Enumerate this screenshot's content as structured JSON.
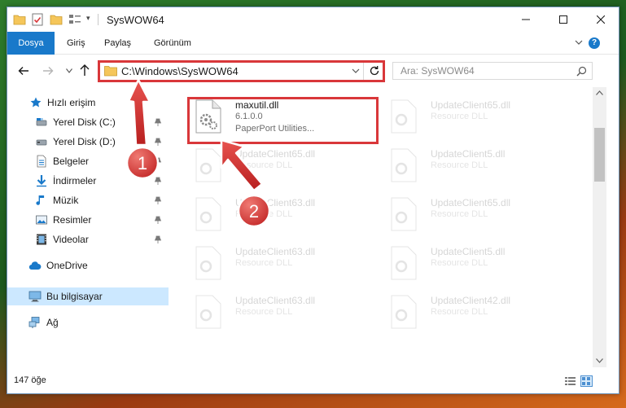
{
  "window": {
    "title": "SysWOW64"
  },
  "ribbon": {
    "tabs": [
      {
        "label": "Dosya"
      },
      {
        "label": "Giriş"
      },
      {
        "label": "Paylaş"
      },
      {
        "label": "Görünüm"
      }
    ],
    "help_label": "?"
  },
  "address": {
    "path": "C:\\Windows\\SysWOW64"
  },
  "search": {
    "placeholder": "Ara: SysWOW64"
  },
  "sidebar": {
    "items": [
      {
        "label": "Hızlı erişim",
        "icon": "star-icon",
        "pinned": false
      },
      {
        "label": "Yerel Disk (C:)",
        "icon": "drive-icon",
        "pinned": true
      },
      {
        "label": "Yerel Disk (D:)",
        "icon": "drive-icon",
        "pinned": true
      },
      {
        "label": "Belgeler",
        "icon": "documents-icon",
        "pinned": true
      },
      {
        "label": "İndirmeler",
        "icon": "download-icon",
        "pinned": true
      },
      {
        "label": "Müzik",
        "icon": "music-icon",
        "pinned": true
      },
      {
        "label": "Resimler",
        "icon": "pictures-icon",
        "pinned": true
      },
      {
        "label": "Videolar",
        "icon": "video-icon",
        "pinned": true
      },
      {
        "label": "OneDrive",
        "icon": "cloud-icon",
        "pinned": false
      },
      {
        "label": "Bu bilgisayar",
        "icon": "computer-icon",
        "pinned": false,
        "selected": true
      },
      {
        "label": "Ağ",
        "icon": "network-icon",
        "pinned": false
      }
    ]
  },
  "files": {
    "highlighted": {
      "name": "maxutil.dll",
      "version": "6.1.0.0",
      "description": "PaperPort Utilities..."
    },
    "faded": [
      {
        "name": "UpdateClient65.dll",
        "description": "Resource DLL"
      },
      {
        "name": "UpdateClient65.dll",
        "description": "Resource DLL"
      },
      {
        "name": "UpdateClient5.dll",
        "description": "Resource DLL"
      },
      {
        "name": "UpdateClient63.dll",
        "description": "Resource DLL"
      },
      {
        "name": "UpdateClient65.dll",
        "description": "Resource DLL"
      },
      {
        "name": "UpdateClient63.dll",
        "description": "Resource DLL"
      },
      {
        "name": "UpdateClient5.dll",
        "description": "Resource DLL"
      },
      {
        "name": "UpdateClient63.dll",
        "description": "Resource DLL"
      },
      {
        "name": "UpdateClient42.dll",
        "description": "Resource DLL"
      }
    ]
  },
  "status": {
    "count_text": "147 öğe"
  },
  "annotations": {
    "step1": "1",
    "step2": "2"
  },
  "colors": {
    "accent": "#1979ca",
    "highlight_red": "#d9373a",
    "selection": "#cce8ff"
  }
}
